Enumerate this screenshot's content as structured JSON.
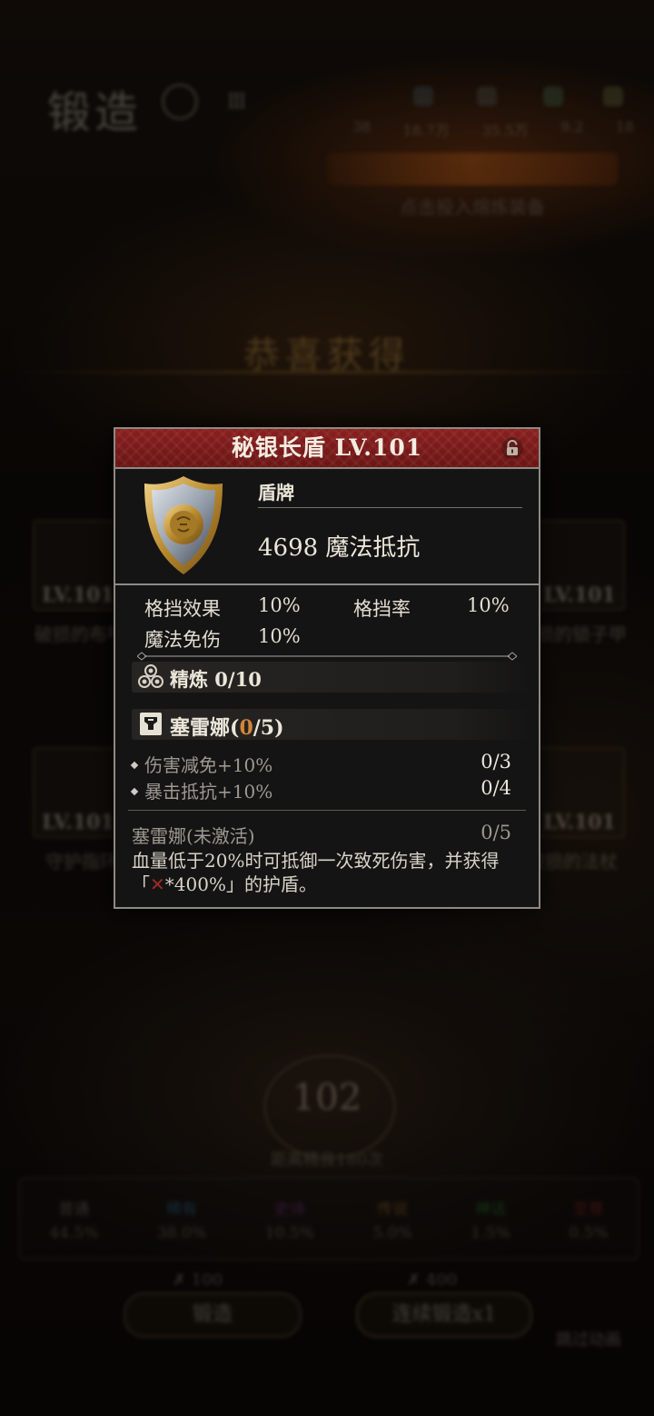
{
  "background": {
    "title": "锻造",
    "tag": "Ⅲ",
    "stats": [
      "38",
      "18.7万",
      "35.5万",
      "9.2",
      "18"
    ],
    "progress_text": "点击投入熔炼装备",
    "congrats": "恭喜获得",
    "items": [
      {
        "level": "LV.101",
        "name": "破损的布甲"
      },
      {
        "level": "LV.101",
        "name": "破损的锁子甲"
      },
      {
        "level": "LV.101",
        "name": "守护指环"
      },
      {
        "level": "LV.101",
        "name": "破损的法杖"
      }
    ],
    "forge_count": "102",
    "forge_count_sub": "距离精良180次",
    "rates": [
      {
        "name": "普通",
        "value": "44.5%",
        "color": "#8b847a"
      },
      {
        "name": "稀有",
        "value": "38.0%",
        "color": "#2e7fa8"
      },
      {
        "name": "史诗",
        "value": "10.5%",
        "color": "#8a3aa0"
      },
      {
        "name": "传说",
        "value": "5.0%",
        "color": "#a8742a"
      },
      {
        "name": "神话",
        "value": "1.5%",
        "color": "#2e8a3a"
      },
      {
        "name": "至尊",
        "value": "0.5%",
        "color": "#a83030"
      }
    ],
    "cost_left": "✗ 100",
    "cost_right": "✗ 400",
    "forge_button": "锻造",
    "auto_button": "连续锻造x1",
    "auto_label": "跳过动画"
  },
  "tooltip": {
    "title": "秘银长盾 LV.101",
    "type": "盾牌",
    "main_stat": "4698 魔法抵抗",
    "attributes": [
      {
        "label": "格挡效果",
        "value": "10%"
      },
      {
        "label": "格挡率",
        "value": "10%"
      },
      {
        "label": "魔法免伤",
        "value": "10%"
      }
    ],
    "refine": "精炼 0/10",
    "set_name": "塞雷娜",
    "set_open": "(",
    "set_current": "0",
    "set_total": "/5)",
    "bonuses": [
      {
        "text": "伤害减免+10%",
        "count": "0/3"
      },
      {
        "text": "暴击抵抗+10%",
        "count": "0/4"
      }
    ],
    "set_status": "塞雷娜(未激活)",
    "set_status_count": "0/5",
    "desc_line1": "血量低于20%时可抵御一次致死伤害，并获得",
    "desc_prefix": "「",
    "desc_x": "✕",
    "desc_suffix": "*400%」的护盾。"
  },
  "colors": {
    "header_red": "#8a1f1f",
    "accent_orange": "#d4853a",
    "border": "#8e8a82"
  }
}
